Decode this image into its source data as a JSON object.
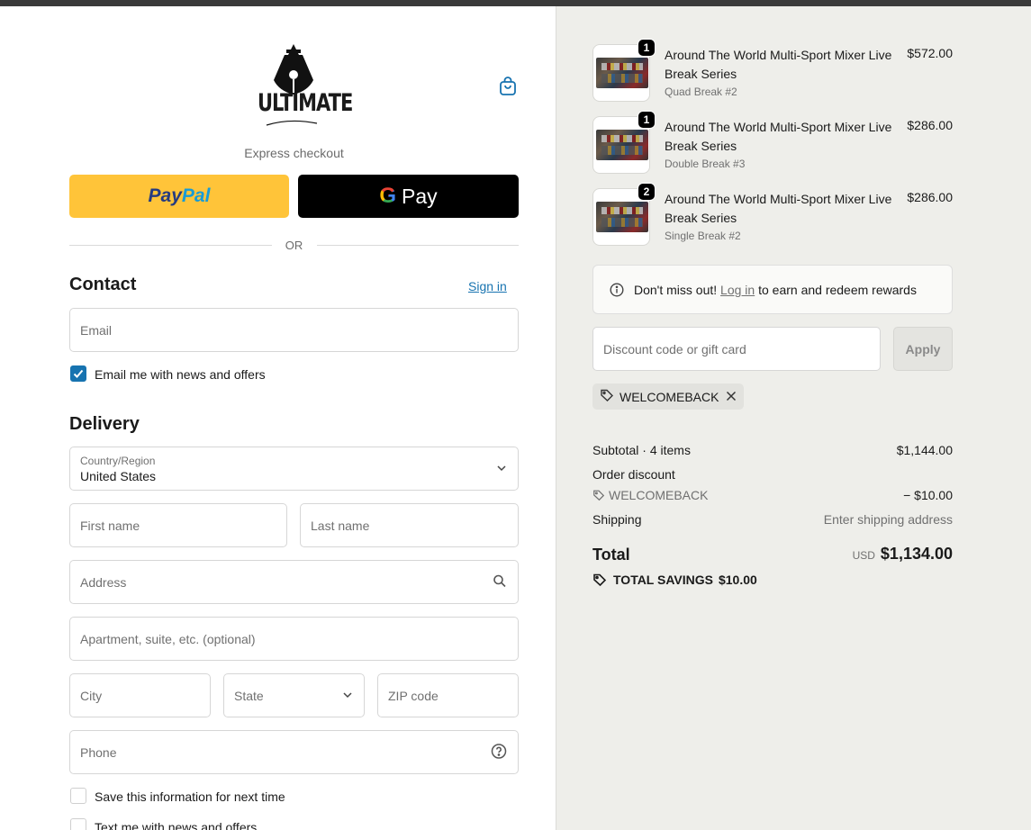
{
  "brand": {
    "logo_text": "ULTIMATE"
  },
  "express": {
    "label": "Express checkout",
    "paypal_a": "Pay",
    "paypal_b": "Pal",
    "gpay_g": "G",
    "gpay_label": "Pay",
    "or": "OR"
  },
  "contact": {
    "heading": "Contact",
    "signin": "Sign in",
    "email_placeholder": "Email",
    "news_label": "Email me with news and offers",
    "news_checked": true
  },
  "delivery": {
    "heading": "Delivery",
    "country_label": "Country/Region",
    "country_value": "United States",
    "first_name": "First name",
    "last_name": "Last name",
    "address": "Address",
    "apartment": "Apartment, suite, etc. (optional)",
    "city": "City",
    "state": "State",
    "zip": "ZIP code",
    "phone": "Phone",
    "save_info": "Save this information for next time",
    "text_me": "Text me with news and offers"
  },
  "cart": {
    "items": [
      {
        "qty": "1",
        "title": "Around The World Multi-Sport Mixer Live Break Series",
        "variant": "Quad Break #2",
        "price": "$572.00"
      },
      {
        "qty": "1",
        "title": "Around The World Multi-Sport Mixer Live Break Series",
        "variant": "Double Break #3",
        "price": "$286.00"
      },
      {
        "qty": "2",
        "title": "Around The World Multi-Sport Mixer Live Break Series",
        "variant": "Single Break #2",
        "price": "$286.00"
      }
    ]
  },
  "rewards": {
    "prefix": "Don't miss out!",
    "login": "Log in",
    "suffix": "to earn and redeem rewards"
  },
  "discount": {
    "placeholder": "Discount code or gift card",
    "apply": "Apply",
    "applied_code": "WELCOMEBACK"
  },
  "summary": {
    "subtotal_label": "Subtotal · 4 items",
    "subtotal_value": "$1,144.00",
    "order_discount_label": "Order discount",
    "discount_code": "WELCOMEBACK",
    "discount_value": "− $10.00",
    "shipping_label": "Shipping",
    "shipping_value": "Enter shipping address",
    "total_label": "Total",
    "currency": "USD",
    "total_value": "$1,134.00",
    "savings": "TOTAL SAVINGS",
    "savings_value": "$10.00"
  },
  "icons": {
    "bag": "shopping-bag-icon",
    "search": "search-icon",
    "help": "question-circle-icon",
    "chevron": "chevron-down-icon",
    "tag": "tag-icon",
    "info": "info-icon",
    "close": "close-icon"
  },
  "colors": {
    "accent": "#1773b0",
    "paypal": "#ffc439",
    "panel": "#eeeeea"
  }
}
